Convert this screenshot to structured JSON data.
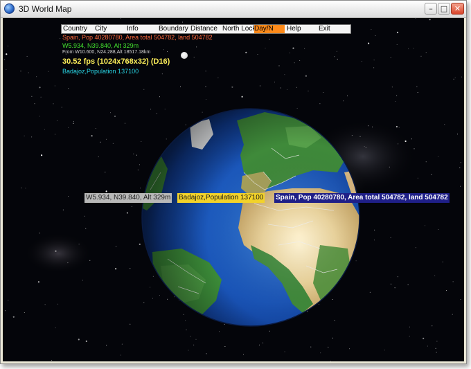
{
  "window": {
    "title": "3D World Map"
  },
  "menu": {
    "items": [
      {
        "label": "Country"
      },
      {
        "label": "City"
      },
      {
        "label": "Info"
      },
      {
        "label": "Boundary"
      },
      {
        "label": "Distance"
      },
      {
        "label": "North Lock"
      },
      {
        "label": "Day/N",
        "active": true
      },
      {
        "label": "Help"
      },
      {
        "label": "Exit"
      }
    ]
  },
  "hud": {
    "country_info": "Spain, Pop  40280780, Area total 504782, land 504782",
    "coordinates": "W5.934, N39.840, Alt 329m",
    "from_info": "From W10.600, N24.288,Alt 18517.18km",
    "fps": "30.52 fps (1024x768x32) (D16)",
    "city_info": "Badajoz,Population  137100"
  },
  "overlay": {
    "coords": "W5.934, N39.840, Alt 329m",
    "city": "Badajoz,Population  137100",
    "country": "Spain, Pop  40280780, Area total 504782, land 504782"
  },
  "colors": {
    "menu_active": "#ff8a1a",
    "country_text": "#ff6a3c",
    "coords_text": "#44e12f",
    "fps_text": "#fff05a",
    "city_text": "#29d6e6",
    "strip_city_bg": "#f2d22a",
    "strip_country_bg": "#1f1f87"
  },
  "icons": {
    "app": "globe-icon",
    "minimize": "minimize-icon",
    "maximize": "maximize-icon",
    "close": "close-icon"
  }
}
